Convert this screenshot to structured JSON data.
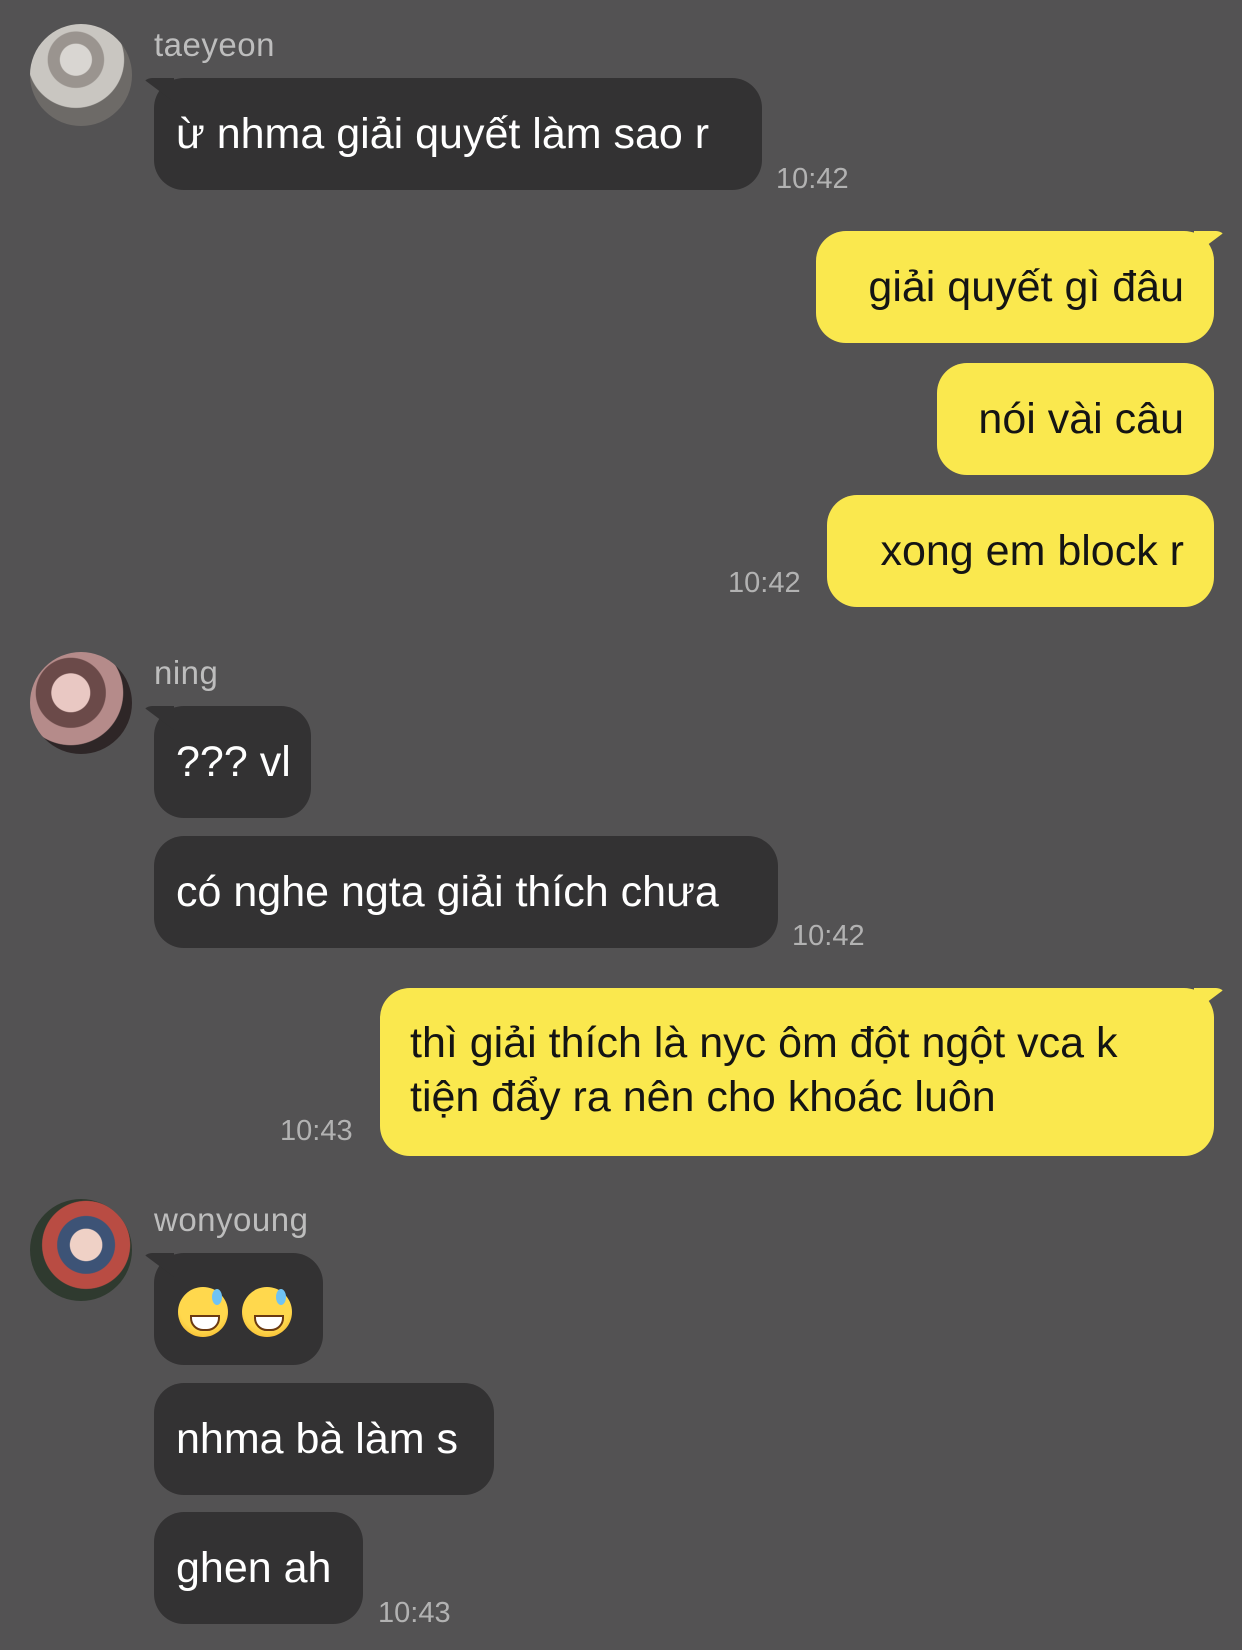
{
  "messages": {
    "taeyeon": {
      "name": "taeyeon",
      "text1": "ừ nhma giải quyết làm sao r",
      "time": "10:42"
    },
    "me1": {
      "text1": "giải quyết gì đâu",
      "text2": "nói vài câu",
      "text3": "xong em block r",
      "time": "10:42"
    },
    "ning": {
      "name": "ning",
      "text1": "??? vl",
      "text2": "có nghe ngta giải thích chưa",
      "time": "10:42"
    },
    "me2": {
      "line1": "thì giải thích là nyc ôm đột ngột vca k",
      "line2": "tiện đẩy ra nên cho khoác luôn",
      "time": "10:43"
    },
    "wonyoung": {
      "name": "wonyoung",
      "emoji_icons": [
        "sweat-smile-emoji",
        "sweat-smile-emoji"
      ],
      "text2": "nhma bà làm s",
      "text3": "ghen ah",
      "time": "10:43"
    }
  }
}
